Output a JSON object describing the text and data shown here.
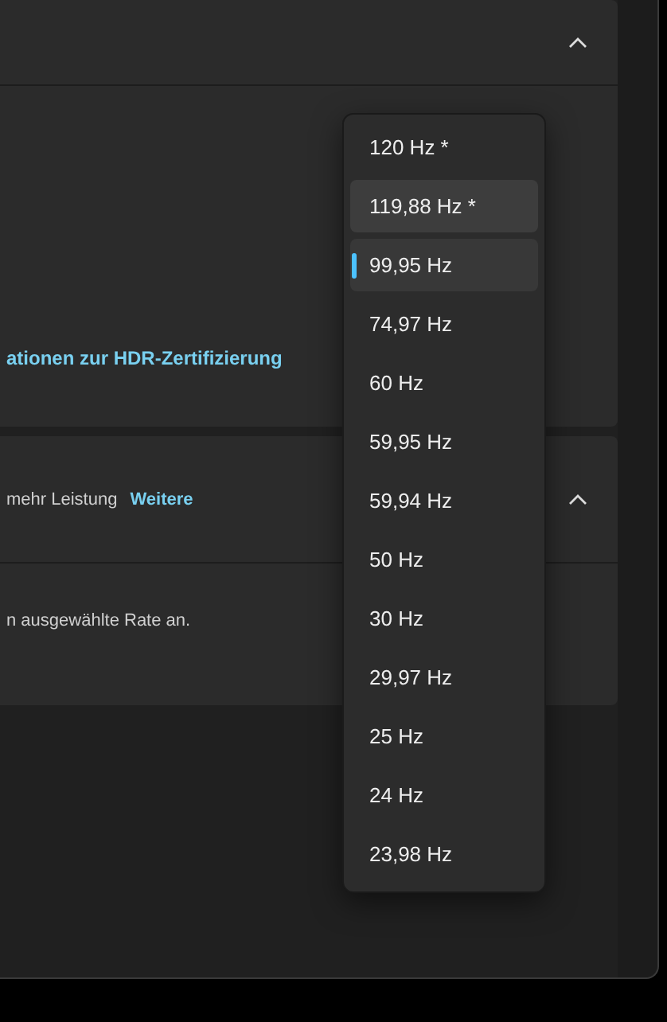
{
  "sections": [
    {
      "expanded": true,
      "body_link": "ationen zur HDR-Zertifizierung"
    },
    {
      "expanded": true,
      "header_text": "mehr Leistung",
      "header_link": "Weitere",
      "body_text": "n ausgewählte Rate an."
    }
  ],
  "refresh_menu": {
    "options": [
      {
        "label": "120 Hz *",
        "hovered": false,
        "selected": false
      },
      {
        "label": "119,88 Hz *",
        "hovered": true,
        "selected": false
      },
      {
        "label": "99,95 Hz",
        "hovered": false,
        "selected": true
      },
      {
        "label": "74,97 Hz",
        "hovered": false,
        "selected": false
      },
      {
        "label": "60 Hz",
        "hovered": false,
        "selected": false
      },
      {
        "label": "59,95 Hz",
        "hovered": false,
        "selected": false
      },
      {
        "label": "59,94 Hz",
        "hovered": false,
        "selected": false
      },
      {
        "label": "50 Hz",
        "hovered": false,
        "selected": false
      },
      {
        "label": "30 Hz",
        "hovered": false,
        "selected": false
      },
      {
        "label": "29,97 Hz",
        "hovered": false,
        "selected": false
      },
      {
        "label": "25 Hz",
        "hovered": false,
        "selected": false
      },
      {
        "label": "24 Hz",
        "hovered": false,
        "selected": false
      },
      {
        "label": "23,98 Hz",
        "hovered": false,
        "selected": false
      }
    ]
  }
}
